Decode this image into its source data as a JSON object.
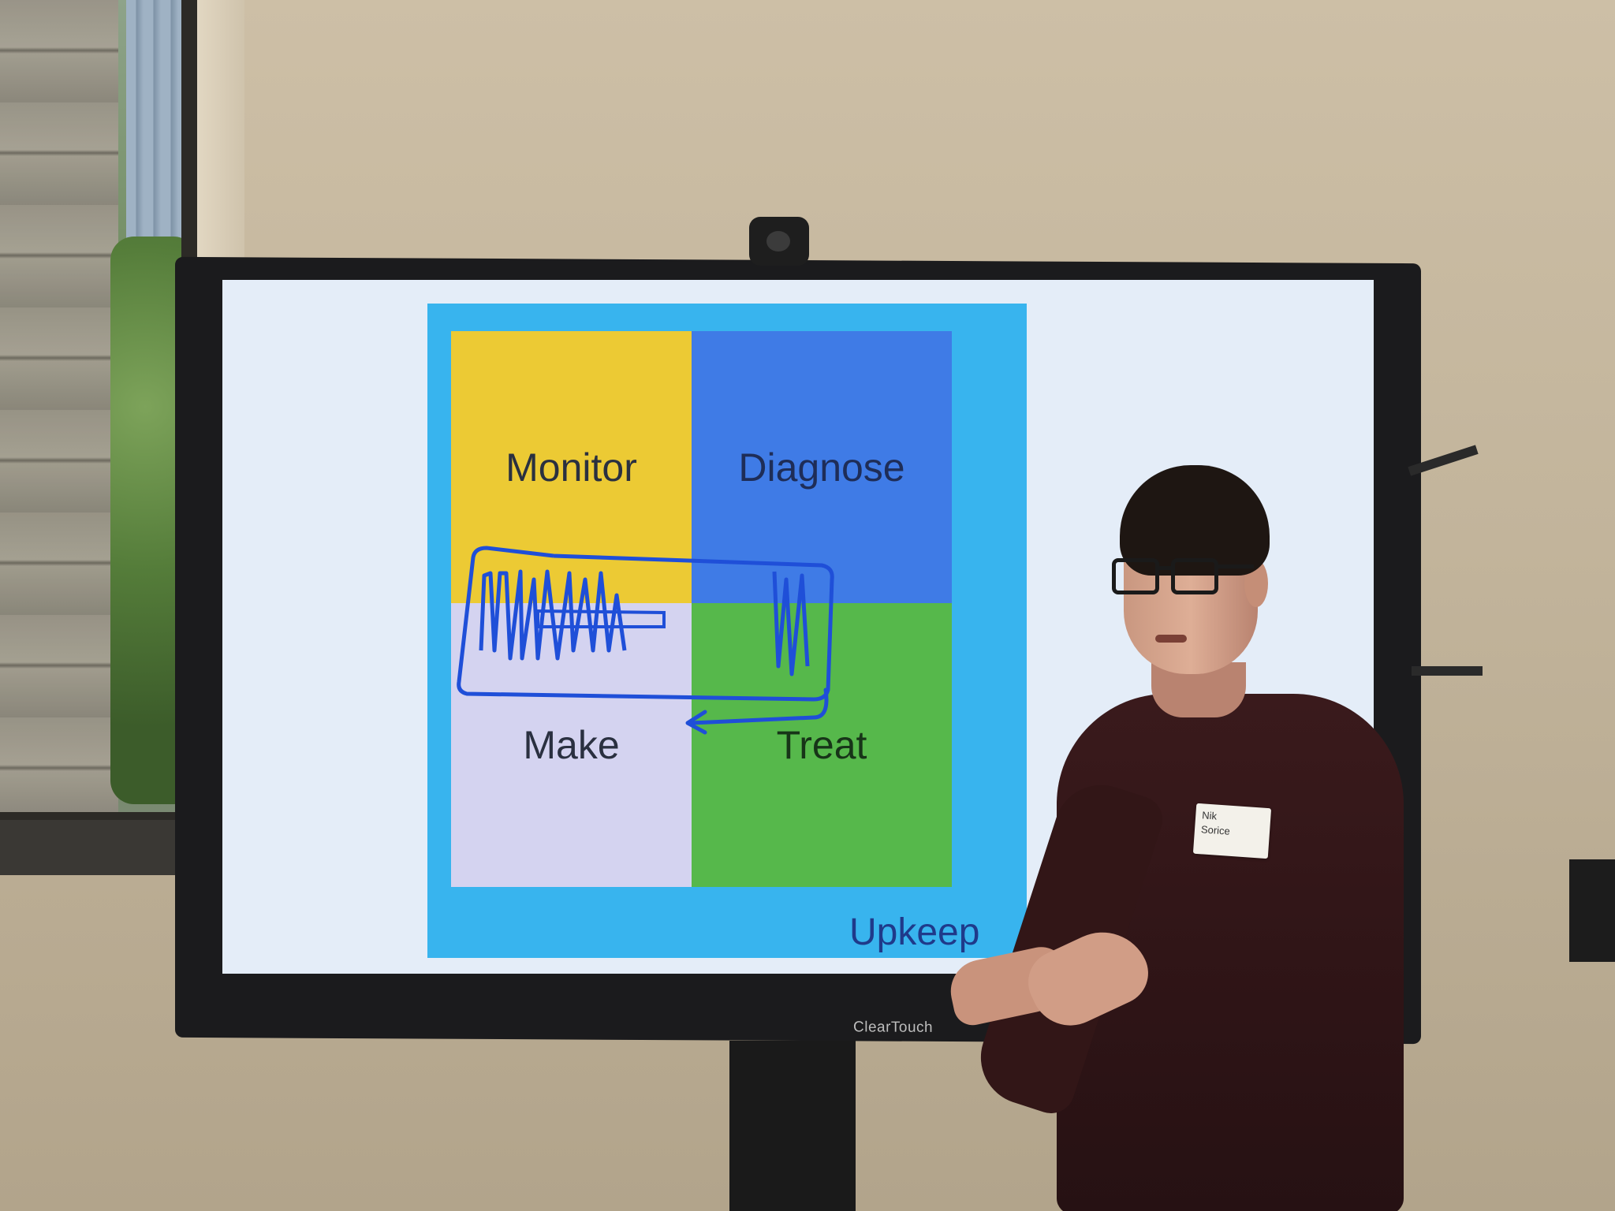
{
  "slide": {
    "quadrants": {
      "monitor": "Monitor",
      "diagnose": "Diagnose",
      "make": "Make",
      "treat": "Treat"
    },
    "frame_label": "Upkeep"
  },
  "monitor_brand": "ClearTouch",
  "name_tag": {
    "line1": "Nik",
    "line2": "Sorice"
  },
  "colors": {
    "monitor_quadrant": "#ecca34",
    "diagnose_quadrant": "#3f7be6",
    "make_quadrant": "#d4d3f0",
    "treat_quadrant": "#56b84b",
    "upkeep_frame": "#38b4ee",
    "annotation_ink": "#1f4fd8"
  }
}
